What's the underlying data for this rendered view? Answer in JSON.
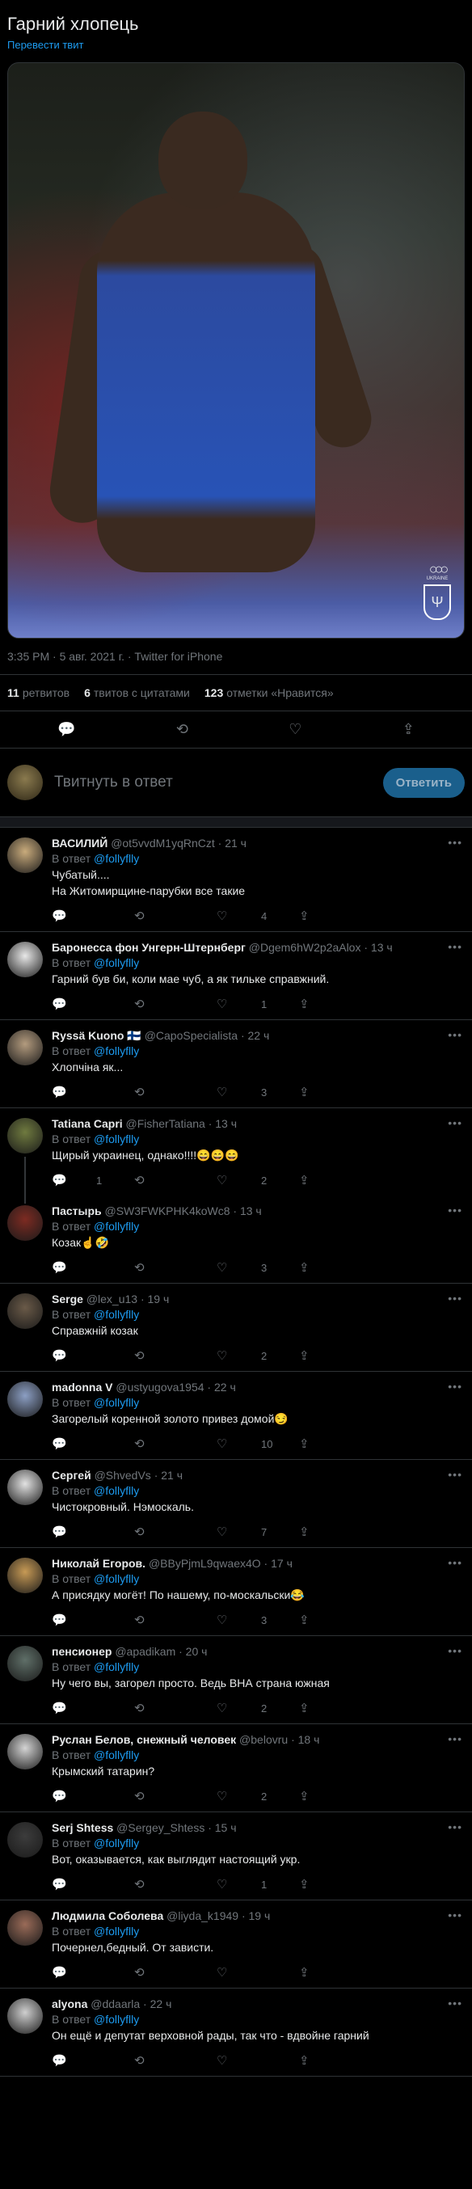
{
  "tweet": {
    "text": "Гарний хлопець",
    "translate": "Перевести твит",
    "meta": "3:35 PM · 5 авг. 2021 г. · Twitter for iPhone",
    "counts": [
      {
        "num": "11",
        "label": "ретвитов"
      },
      {
        "num": "6",
        "label": "твитов с цитатами"
      },
      {
        "num": "123",
        "label": "отметки «Нравится»"
      }
    ],
    "image_label": "UKRAINE"
  },
  "reply_box": {
    "placeholder": "Твитнуть в ответ",
    "button": "Ответить"
  },
  "reply_prefix": "В ответ",
  "reply_to": "@follyflly",
  "icons": {
    "reply": "reply-icon",
    "retweet": "retweet-icon",
    "like": "like-icon",
    "share": "share-icon"
  },
  "replies": [
    {
      "name": "ВАСИЛИЙ",
      "handle": "@ot5vvdM1yqRnCzt · 21 ч",
      "text1": "Чубатый....",
      "text2": "На Житомирщине-парубки все такие",
      "reply": "",
      "rt": "",
      "likes": "4",
      "avatar": "#c9ab7c"
    },
    {
      "name": "Баронесса фон Унгерн-Штернберг",
      "handle": "@Dgem6hW2p2aAlox · 13 ч",
      "text1": "Гарний був би, коли мае чуб, а як тильке справжний.",
      "text2": "",
      "reply": "",
      "rt": "",
      "likes": "1",
      "avatar": "#e8e8e8"
    },
    {
      "name": "Ryssä Kuono 🇫🇮",
      "handle": "@CapoSpecialista · 22 ч",
      "text1": "Хлопчіна як...",
      "text2": "",
      "reply": "",
      "rt": "",
      "likes": "3",
      "avatar": "#b39b7e"
    },
    {
      "name": "Tatiana Capri",
      "handle": "@FisherTatiana · 13 ч",
      "text1": "Щирый украинец, однако!!!!😄😄😄",
      "text2": "",
      "reply": "1",
      "rt": "",
      "likes": "2",
      "avatar": "#6f7a3f"
    },
    {
      "name": "Пастырь",
      "handle": "@SW3FWKPHK4koWc8 · 13 ч",
      "text1": "Козак☝️🤣",
      "text2": "",
      "reply": "",
      "rt": "",
      "likes": "3",
      "avatar": "#7d2b22"
    },
    {
      "name": "Serge",
      "handle": "@lex_u13 · 19 ч",
      "text1": "Справжній козак",
      "text2": "",
      "reply": "",
      "rt": "",
      "likes": "2",
      "avatar": "#6a5a48"
    },
    {
      "name": "madonna V",
      "handle": "@ustyugova1954 · 22 ч",
      "text1": "Загорелый коренной золото привез домой😏",
      "text2": "",
      "reply": "",
      "rt": "",
      "likes": "10",
      "avatar": "#8c9fc4"
    },
    {
      "name": "Сергей",
      "handle": "@ShvedVs · 21 ч",
      "text1": "Чистокровный. Нэмоскаль.",
      "text2": "",
      "reply": "",
      "rt": "",
      "likes": "7",
      "avatar": "#e2e2e2"
    },
    {
      "name": "Николай Егоров.",
      "handle": "@BByPjmL9qwaex4O · 17 ч",
      "text1": "А присядку могёт! По нашему, по-москальски😂",
      "text2": "",
      "reply": "",
      "rt": "",
      "likes": "3",
      "avatar": "#c79a55"
    },
    {
      "name": "пенсионер",
      "handle": "@apadikam · 20 ч",
      "text1": "Ну чего вы, загорел просто. Ведь ВНА страна южная",
      "text2": "",
      "reply": "",
      "rt": "",
      "likes": "2",
      "avatar": "#5f6f68"
    },
    {
      "name": "Руслан Белов, снежный человек",
      "handle": "@belovru · 18 ч",
      "text1": "Крымский татарин?",
      "text2": "",
      "reply": "",
      "rt": "",
      "likes": "2",
      "avatar": "#d4d4d4"
    },
    {
      "name": "Serj Shtess",
      "handle": "@Sergey_Shtess · 15 ч",
      "text1": "Вот, оказывается, как выглядит  настоящий укр.",
      "text2": "",
      "reply": "",
      "rt": "",
      "likes": "1",
      "avatar": "#3c3c3c"
    },
    {
      "name": "Людмила Соболева",
      "handle": "@liyda_k1949 · 19 ч",
      "text1": "Почернел,бедный. От зависти.",
      "text2": "",
      "reply": "",
      "rt": "",
      "likes": "",
      "avatar": "#9a6b58"
    },
    {
      "name": "alyona",
      "handle": "@ddaarla · 22 ч",
      "text1": "Он ещё и депутат верховной рады, так что - вдвойне гарний",
      "text2": "",
      "reply": "",
      "rt": "",
      "likes": "",
      "avatar": "#cfcfcf"
    }
  ]
}
